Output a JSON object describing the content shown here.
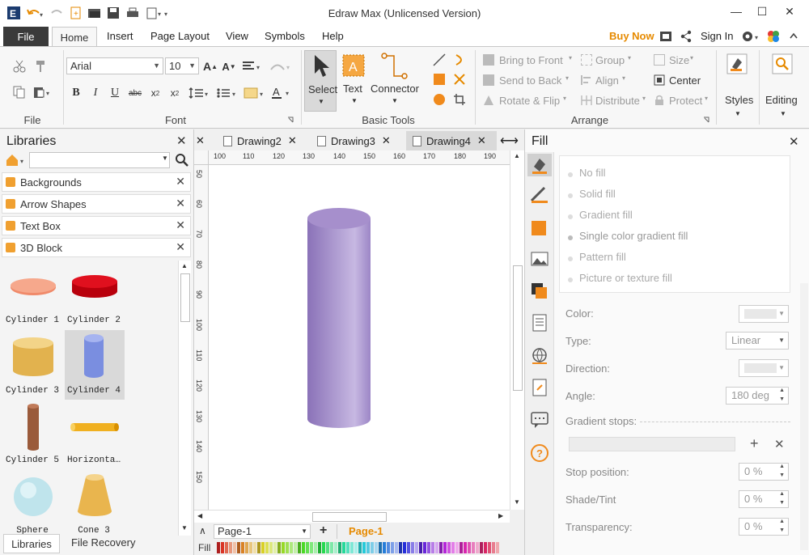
{
  "window": {
    "title": "Edraw Max (Unlicensed Version)"
  },
  "menu": {
    "file": "File",
    "home": "Home",
    "insert": "Insert",
    "page_layout": "Page Layout",
    "view": "View",
    "symbols": "Symbols",
    "help": "Help",
    "buy_now": "Buy Now",
    "sign_in": "Sign In"
  },
  "ribbon": {
    "groups": {
      "file": "File",
      "font": "Font",
      "basic_tools": "Basic Tools",
      "arrange": "Arrange"
    },
    "font_name": "Arial",
    "font_size": "10",
    "select": "Select",
    "text": "Text",
    "connector": "Connector",
    "arrange": {
      "bring_to_front": "Bring to Front",
      "send_to_back": "Send to Back",
      "rotate_flip": "Rotate & Flip",
      "group": "Group",
      "align": "Align",
      "distribute": "Distribute",
      "size": "Size",
      "center": "Center",
      "protect": "Protect"
    },
    "styles": "Styles",
    "editing": "Editing"
  },
  "libraries": {
    "title": "Libraries",
    "search_placeholder": "",
    "sections": [
      "Backgrounds",
      "Arrow Shapes",
      "Text Box",
      "3D Block"
    ],
    "shapes": [
      "Cylinder 1",
      "Cylinder 2",
      "Cylinder 3",
      "Cylinder 4",
      "Cylinder 5",
      "Horizonta…",
      "Sphere",
      "Cone 3"
    ],
    "bottom_tabs": [
      "Libraries",
      "File Recovery"
    ]
  },
  "tabs": [
    "Drawing2",
    "Drawing3",
    "Drawing4"
  ],
  "rulers": {
    "top": [
      "100",
      "110",
      "120",
      "130",
      "140",
      "150",
      "160",
      "170",
      "180",
      "190"
    ],
    "left": [
      "50",
      "60",
      "70",
      "80",
      "90",
      "100",
      "110",
      "120",
      "130",
      "140",
      "150"
    ]
  },
  "pages": {
    "current": "Page-1",
    "tab": "Page-1",
    "fill_label": "Fill"
  },
  "fill_panel": {
    "title": "Fill",
    "options": [
      "No fill",
      "Solid fill",
      "Gradient fill",
      "Single color gradient fill",
      "Pattern fill",
      "Picture or texture fill"
    ],
    "color_label": "Color:",
    "type_label": "Type:",
    "type_value": "Linear",
    "direction_label": "Direction:",
    "angle_label": "Angle:",
    "angle_value": "180 deg",
    "stops_label": "Gradient stops:",
    "stop_position_label": "Stop position:",
    "stop_position_value": "0 %",
    "shade_label": "Shade/Tint",
    "shade_value": "0 %",
    "transparency_label": "Transparency:",
    "transparency_value": "0 %"
  },
  "colors": {
    "accent": "#e68a00",
    "cylinder": "#a08cc8",
    "file_button": "#3a3a3a"
  }
}
